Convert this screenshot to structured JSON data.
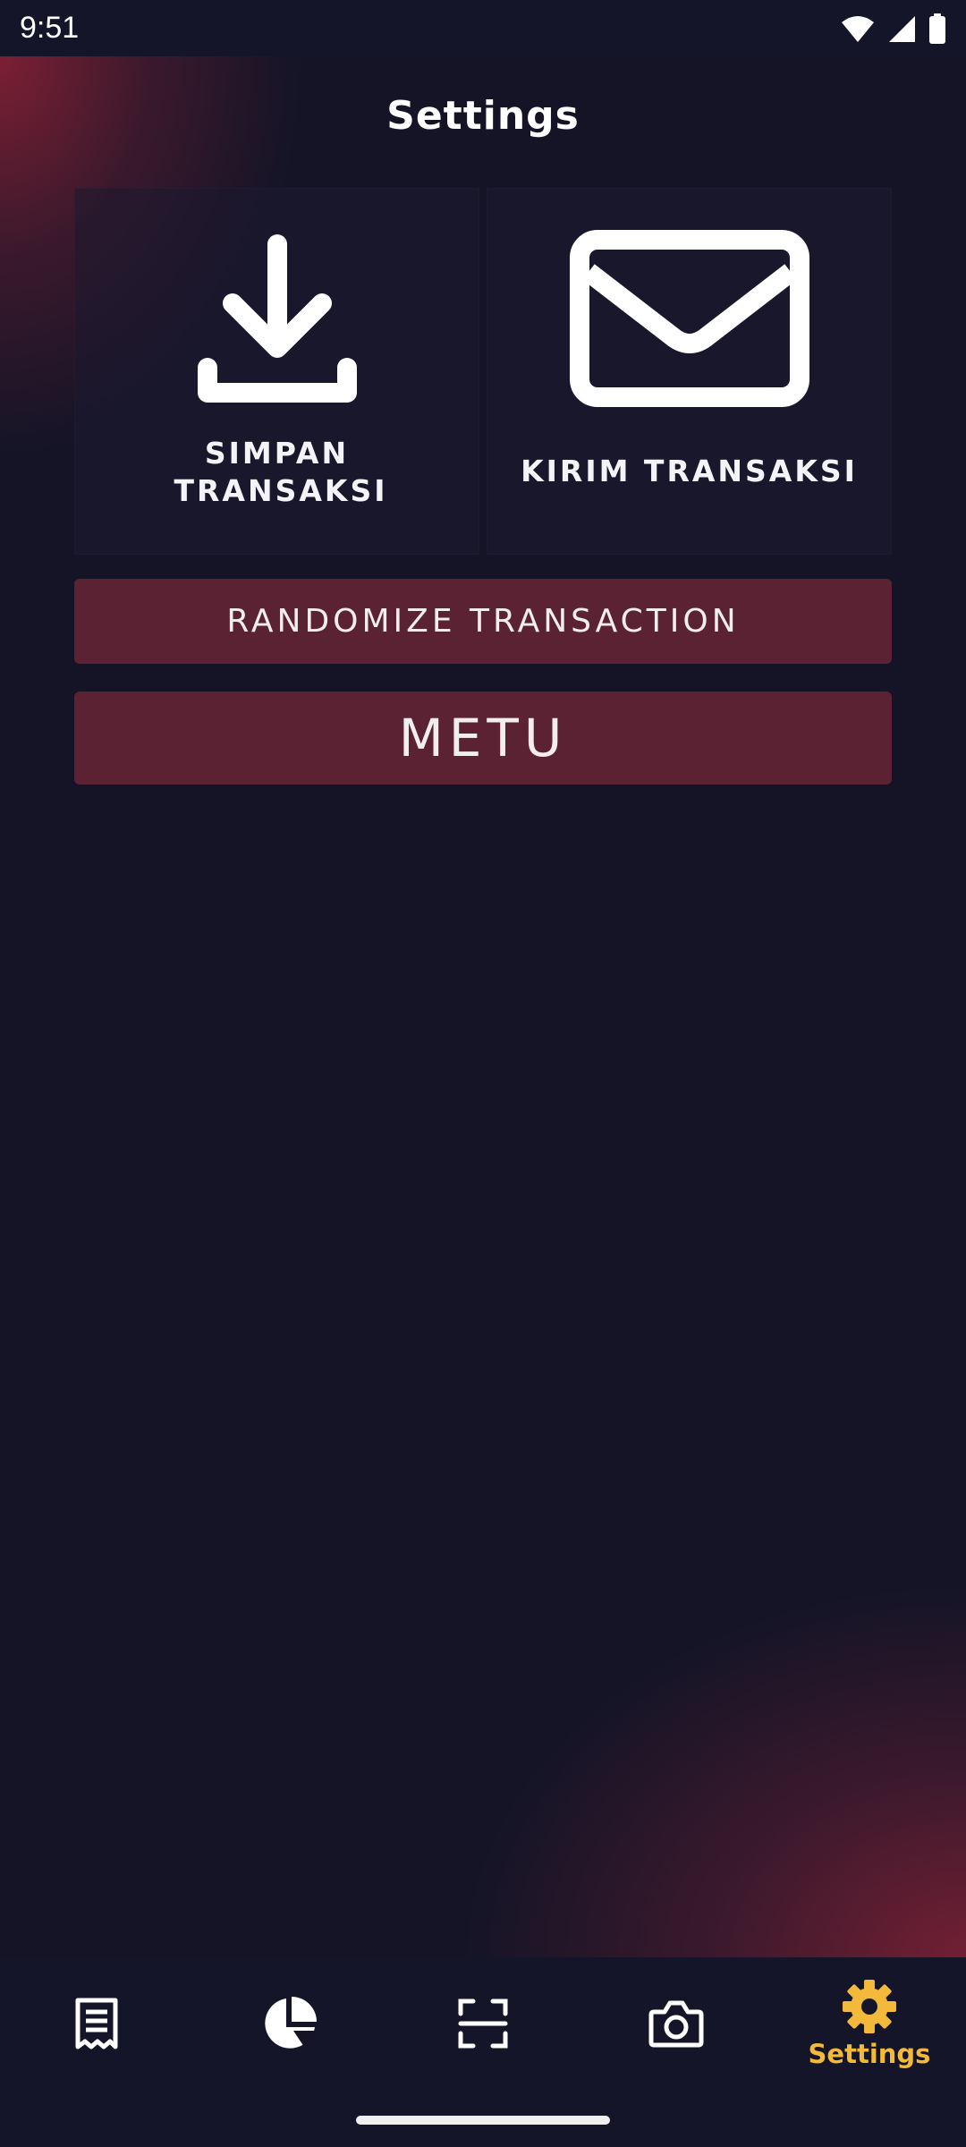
{
  "status_bar": {
    "time": "9:51"
  },
  "header": {
    "title": "Settings"
  },
  "tiles": [
    {
      "icon": "download-icon",
      "label": "SIMPAN TRANSAKSI"
    },
    {
      "icon": "mail-icon",
      "label": "KIRIM TRANSAKSI"
    }
  ],
  "buttons": {
    "randomize_label": "RANDOMIZE TRANSACTION",
    "metu_label": "METU"
  },
  "bottom_nav": {
    "items": [
      {
        "icon": "receipt-icon",
        "label": ""
      },
      {
        "icon": "pie-chart-icon",
        "label": ""
      },
      {
        "icon": "scan-icon",
        "label": ""
      },
      {
        "icon": "camera-icon",
        "label": ""
      },
      {
        "icon": "gear-icon",
        "label": "Settings",
        "active": true
      }
    ],
    "active_color": "#f2b93b"
  },
  "colors": {
    "background": "#151427",
    "button": "#5a2232",
    "accent": "#f2b93b"
  }
}
